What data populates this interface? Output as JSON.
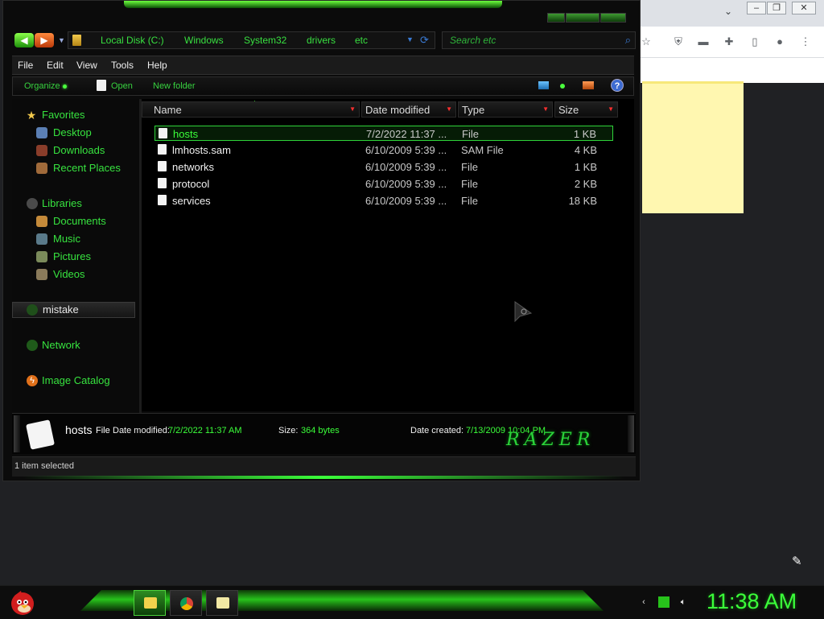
{
  "explorer": {
    "breadcrumbs": [
      "Local Disk (C:)",
      "Windows",
      "System32",
      "drivers",
      "etc"
    ],
    "search": {
      "placeholder": "Search etc"
    },
    "menu": [
      "File",
      "Edit",
      "View",
      "Tools",
      "Help"
    ],
    "commands": {
      "organize": "Organize",
      "open": "Open",
      "new_folder": "New folder"
    },
    "nav": {
      "favorites": "Favorites",
      "desktop": "Desktop",
      "downloads": "Downloads",
      "recent_places": "Recent Places",
      "libraries": "Libraries",
      "documents": "Documents",
      "music": "Music",
      "pictures": "Pictures",
      "videos": "Videos",
      "mistake": "mistake",
      "network": "Network",
      "image_catalog": "Image Catalog"
    },
    "columns": {
      "name": "Name",
      "date_modified": "Date modified",
      "type": "Type",
      "size": "Size"
    },
    "files": [
      {
        "name": "hosts",
        "date": "7/2/2022 11:37 ...",
        "type": "File",
        "size": "1 KB",
        "selected": true
      },
      {
        "name": "lmhosts.sam",
        "date": "6/10/2009 5:39 ...",
        "type": "SAM File",
        "size": "4 KB",
        "selected": false
      },
      {
        "name": "networks",
        "date": "6/10/2009 5:39 ...",
        "type": "File",
        "size": "1 KB",
        "selected": false
      },
      {
        "name": "protocol",
        "date": "6/10/2009 5:39 ...",
        "type": "File",
        "size": "2 KB",
        "selected": false
      },
      {
        "name": "services",
        "date": "6/10/2009 5:39 ...",
        "type": "File",
        "size": "18 KB",
        "selected": false
      }
    ],
    "details": {
      "name": "hosts",
      "type": "File",
      "date_modified_label": "Date modified:",
      "date_modified": "7/2/2022 11:37 AM",
      "size_label": "Size:",
      "size": "364 bytes",
      "date_created_label": "Date created:",
      "date_created": "7/13/2009 10:04 PM"
    },
    "logo_text": "RAZER",
    "status": "1 item selected"
  },
  "taskbar": {
    "clock": "11:38 AM"
  },
  "colors": {
    "accent_green": "#3bff3a",
    "background": "#000000"
  }
}
